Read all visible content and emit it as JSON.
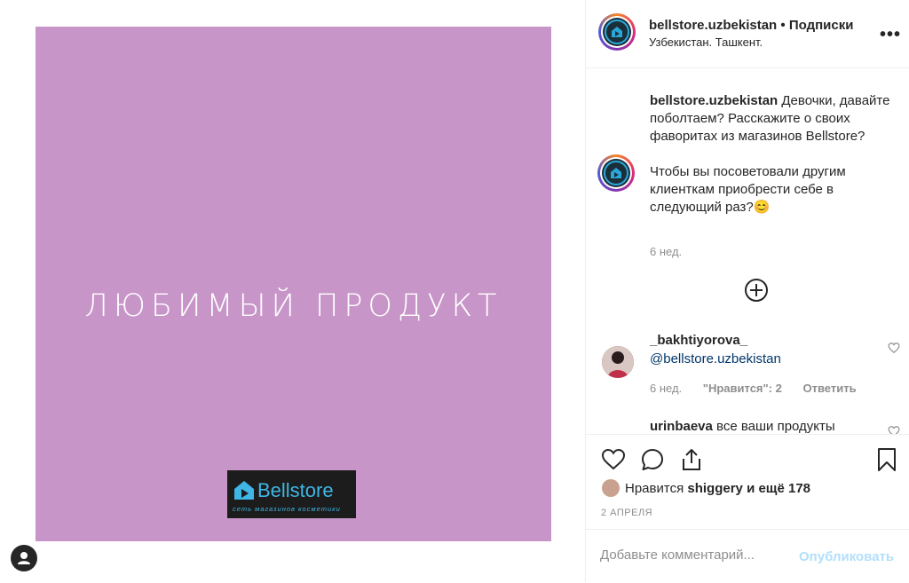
{
  "post": {
    "image_title": "ЛЮБИМЫЙ ПРОДУКТ",
    "image_bg": "#c795c8",
    "brand_name": "Bellstore",
    "brand_tagline": "сеть магазинов косметики",
    "brand_color": "#3fb6e6"
  },
  "header": {
    "username": "bellstore.uzbekistan",
    "dot": "•",
    "follow_label": "Подписки",
    "location": "Узбекистан. Ташкент.",
    "more_icon": "more-horizontal-icon"
  },
  "caption": {
    "username": "bellstore.uzbekistan",
    "text_part1": "Девочки, давайте поболтаем? Расскажите о своих фаворитах из магазинов Bellstore?",
    "text_part2": "Чтобы вы посоветовали другим клиенткам приобрести себе в следующий раз?😊",
    "time": "6 нед."
  },
  "load_more_icon": "plus-circle-icon",
  "comments": [
    {
      "username": "_bakhtiyorova_",
      "mention": "@bellstore.uzbekistan",
      "time": "6 нед.",
      "likes": "\"Нравится\": 2",
      "reply_label": "Ответить"
    },
    {
      "username": "urinbaeva",
      "text": "все ваши продукты"
    }
  ],
  "actions": {
    "like_icon": "heart-icon",
    "comment_icon": "comment-icon",
    "share_icon": "share-icon",
    "save_icon": "bookmark-icon"
  },
  "likes": {
    "prefix": "Нравится",
    "user": "shiggery",
    "suffix": "и ещё 178"
  },
  "date": "2 АПРЕЛЯ",
  "add_comment": {
    "placeholder": "Добавьте комментарий...",
    "publish_label": "Опубликовать"
  }
}
